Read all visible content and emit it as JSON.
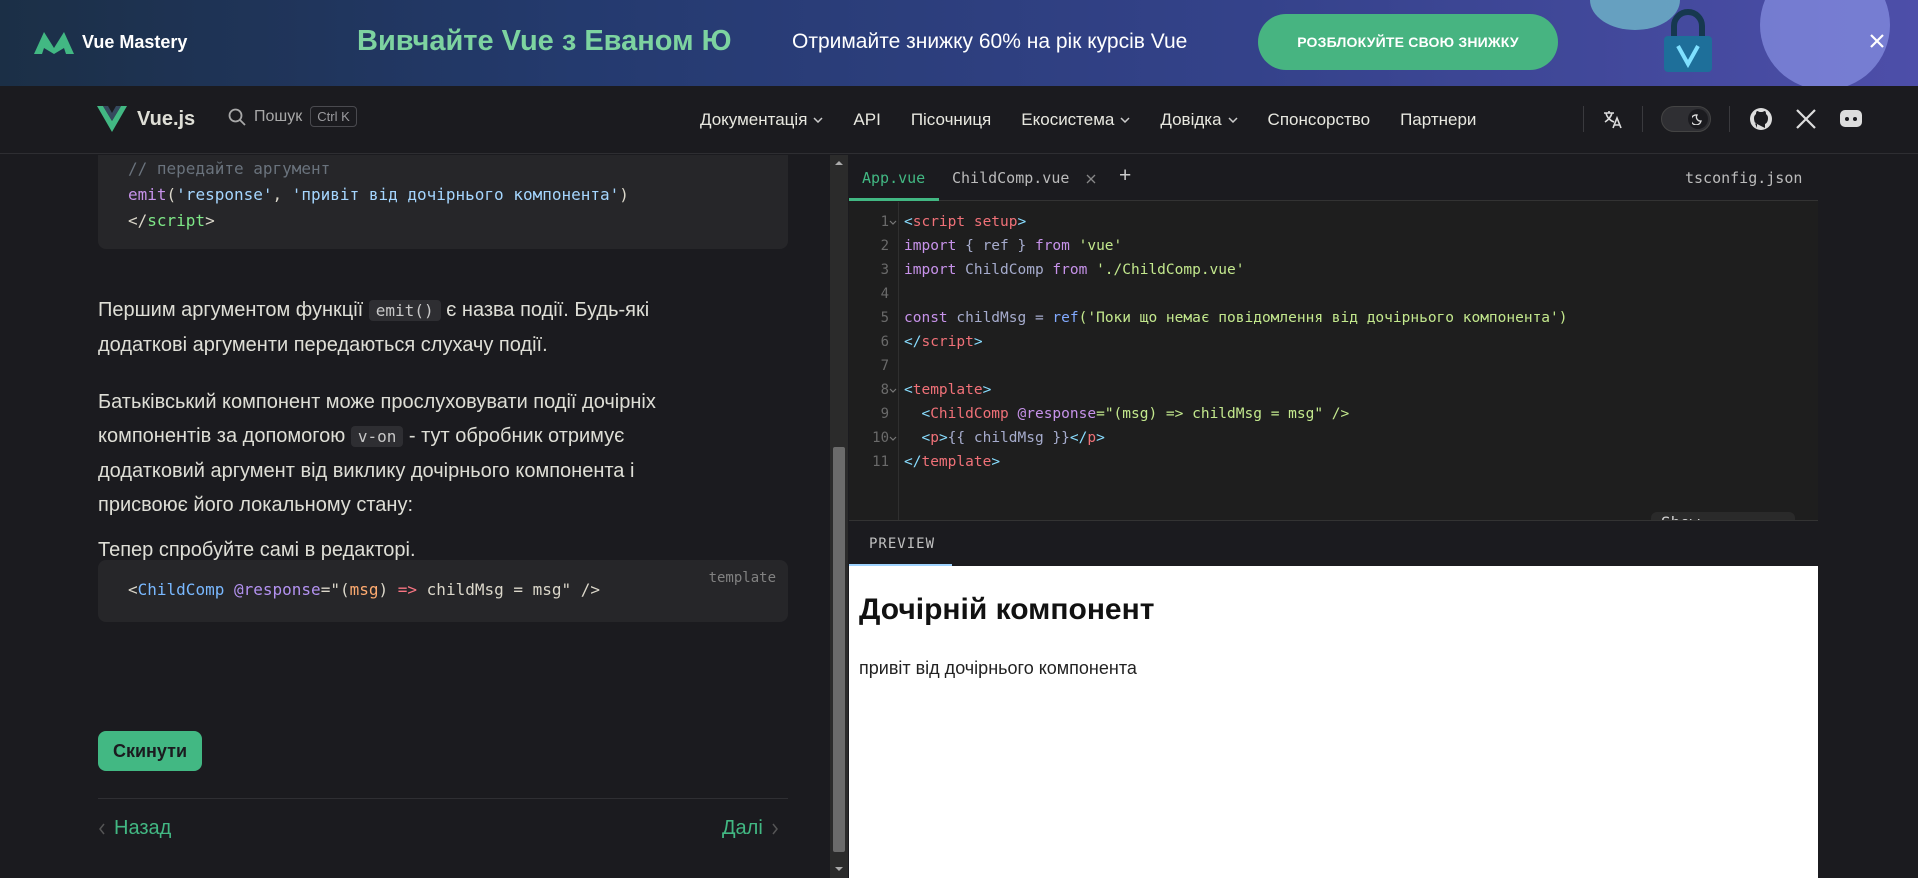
{
  "banner": {
    "logo_text": "Vue Mastery",
    "title": "Вивчайте Vue з Еваном Ю",
    "subtitle": "Отримайте знижку 60% на рік курсів Vue",
    "cta": "РОЗБЛОКУЙТЕ СВОЮ ЗНИЖКУ"
  },
  "nav": {
    "brand": "Vue.js",
    "search_label": "Пошук",
    "search_kbd": "Ctrl K",
    "menu": [
      "Документація",
      "API",
      "Пісочниця",
      "Екосистема",
      "Довідка",
      "Спонсорство",
      "Партнери"
    ]
  },
  "doc": {
    "code1": {
      "comment": "// передайте аргумент",
      "emit_fn": "emit",
      "emit_arg1": "'response'",
      "emit_arg2": "'привіт від дочірнього компонента'",
      "close_tag": "script"
    },
    "p1_a": "Першим аргументом функції ",
    "p1_code": "emit()",
    "p1_b": " є назва події. Будь-які додаткові аргументи передаються слухачу події.",
    "p2_a": "Батьківський компонент може прослуховувати події дочірніх компонентів за допомогою ",
    "p2_code": "v-on",
    "p2_b": " - тут обробник отримує додатковий аргумент від виклику дочірнього компонента і присвоює його локальному стану:",
    "code2": {
      "lang": "template",
      "component": "ChildComp",
      "event": "@response",
      "param": "msg",
      "body": "childMsg = msg"
    },
    "p3": "Тепер спробуйте самі в редакторі.",
    "reset": "Скинути",
    "prev": "Назад",
    "next": "Далі"
  },
  "editor": {
    "tabs": [
      "App.vue",
      "ChildComp.vue"
    ],
    "add_tab": "+",
    "tsconfig": "tsconfig.json",
    "line_numbers": [
      "1",
      "2",
      "3",
      "4",
      "5",
      "6",
      "7",
      "8",
      "9",
      "10",
      "11"
    ],
    "lines": {
      "l1": "script setup",
      "l2_a": "import",
      "l2_b": " { ref } ",
      "l2_c": "from",
      "l2_d": " 'vue'",
      "l3_a": "import",
      "l3_b": " ChildComp ",
      "l3_c": "from",
      "l3_d": " './ChildComp.vue'",
      "l5_a": "const",
      "l5_b": " childMsg = ",
      "l5_c": "ref",
      "l5_d": "('Поки що немає повідомлення від дочірнього компонента')",
      "l6": "script",
      "l8": "template",
      "l9_a": "ChildComp",
      "l9_b": " @response",
      "l9_c": "=\"(msg) => childMsg = msg\" />",
      "l10_a": "p",
      "l10_b": "{{ childMsg }}",
      "l10_c": "p",
      "l11": "template"
    },
    "show_error": "Show Error",
    "preview_label": "PREVIEW",
    "preview_heading": "Дочірній компонент",
    "preview_text": "привіт від дочірнього компонента"
  },
  "colors": {
    "accent": "#42b883",
    "banner_cta": "#47b481"
  }
}
